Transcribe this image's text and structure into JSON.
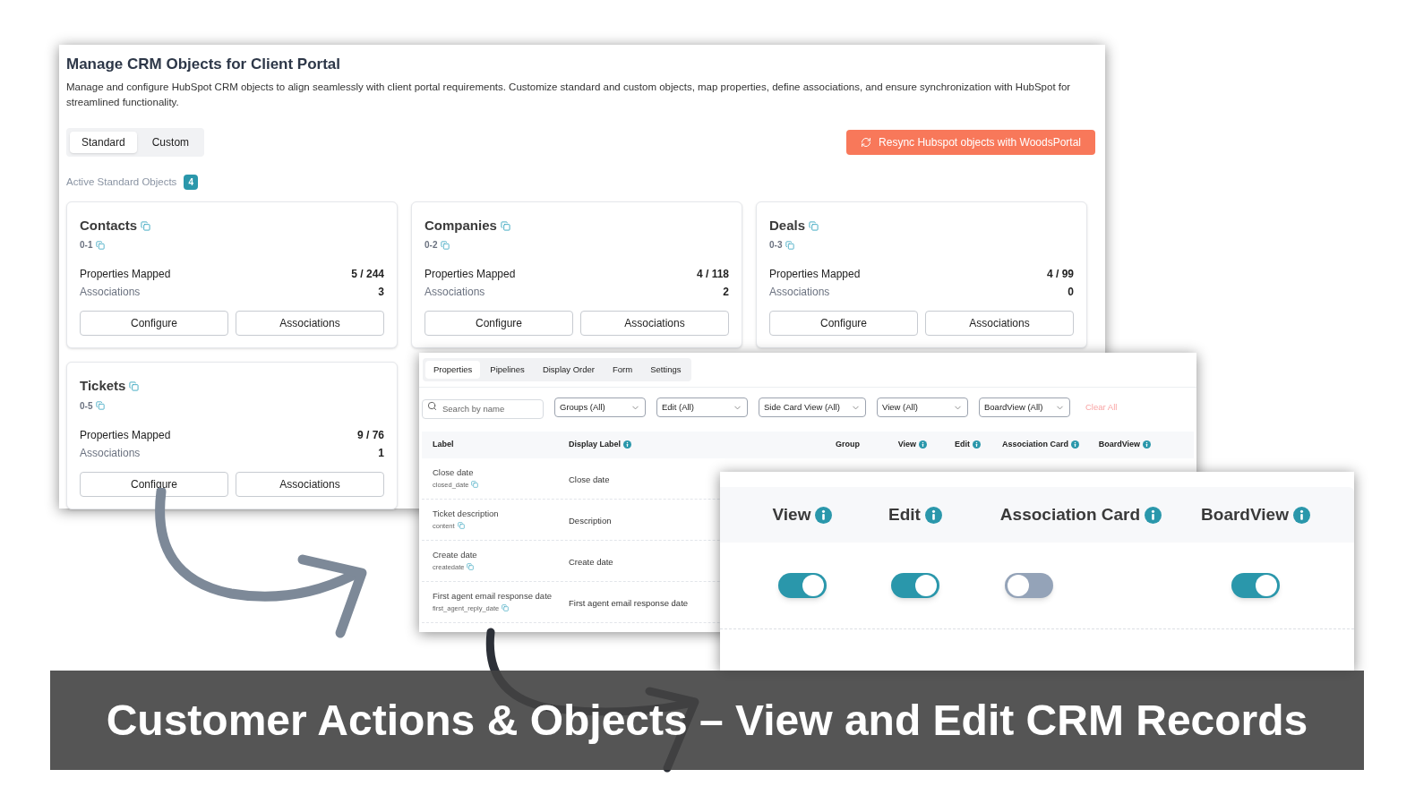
{
  "main_panel": {
    "title": "Manage CRM Objects for Client Portal",
    "description": "Manage and configure HubSpot CRM objects to align seamlessly with client portal requirements. Customize standard and custom objects, map properties, define associations, and ensure synchronization with HubSpot for streamlined functionality.",
    "tabs": [
      {
        "label": "Standard",
        "selected": true
      },
      {
        "label": "Custom",
        "selected": false
      }
    ],
    "resync_button": "Resync Hubspot objects with WoodsPortal",
    "active_label": "Active Standard Objects",
    "active_count": "4",
    "objects": [
      {
        "name": "Contacts",
        "id": "0-1",
        "properties_label": "Properties Mapped",
        "properties_value": "5 / 244",
        "associations_label": "Associations",
        "associations_value": "3",
        "buttons": [
          "Configure",
          "Associations"
        ]
      },
      {
        "name": "Companies",
        "id": "0-2",
        "properties_label": "Properties Mapped",
        "properties_value": "4 / 118",
        "associations_label": "Associations",
        "associations_value": "2",
        "buttons": [
          "Configure",
          "Associations"
        ]
      },
      {
        "name": "Deals",
        "id": "0-3",
        "properties_label": "Properties Mapped",
        "properties_value": "4 / 99",
        "associations_label": "Associations",
        "associations_value": "0",
        "buttons": [
          "Configure",
          "Associations"
        ]
      },
      {
        "name": "Tickets",
        "id": "0-5",
        "properties_label": "Properties Mapped",
        "properties_value": "9 / 76",
        "associations_label": "Associations",
        "associations_value": "1",
        "buttons": [
          "Configure",
          "Associations"
        ]
      }
    ]
  },
  "properties_panel": {
    "tabs": [
      {
        "label": "Properties",
        "selected": true
      },
      {
        "label": "Pipelines",
        "selected": false
      },
      {
        "label": "Display Order",
        "selected": false
      },
      {
        "label": "Form",
        "selected": false
      },
      {
        "label": "Settings",
        "selected": false
      }
    ],
    "search": {
      "placeholder": "Search by name"
    },
    "filters": [
      "Groups (All)",
      "Edit (All)",
      "Side Card View (All)",
      "View (All)",
      "BoardView (All)"
    ],
    "clear_all": "Clear All",
    "columns": [
      {
        "label": "Label",
        "info": false
      },
      {
        "label": "Display Label",
        "info": true
      },
      {
        "label": "Group",
        "info": false
      },
      {
        "label": "View",
        "info": true
      },
      {
        "label": "Edit",
        "info": true
      },
      {
        "label": "Association Card",
        "info": true
      },
      {
        "label": "BoardView",
        "info": true
      }
    ],
    "rows": [
      {
        "label": "Close date",
        "key": "closed_date",
        "display_label": "Close date"
      },
      {
        "label": "Ticket description",
        "key": "content",
        "display_label": "Description"
      },
      {
        "label": "Create date",
        "key": "createdate",
        "display_label": "Create date"
      },
      {
        "label": "First agent email response date",
        "key": "first_agent_reply_date",
        "display_label": "First agent email response date"
      }
    ]
  },
  "toggle_panel": {
    "columns": [
      "View",
      "Edit",
      "Association Card",
      "BoardView"
    ],
    "rows": [
      {
        "toggles": [
          {
            "on": true
          },
          {
            "on": true
          },
          {
            "on": false
          },
          {
            "on": true
          }
        ]
      }
    ]
  },
  "caption": "Customer Actions & Objects – View and Edit CRM Records"
}
